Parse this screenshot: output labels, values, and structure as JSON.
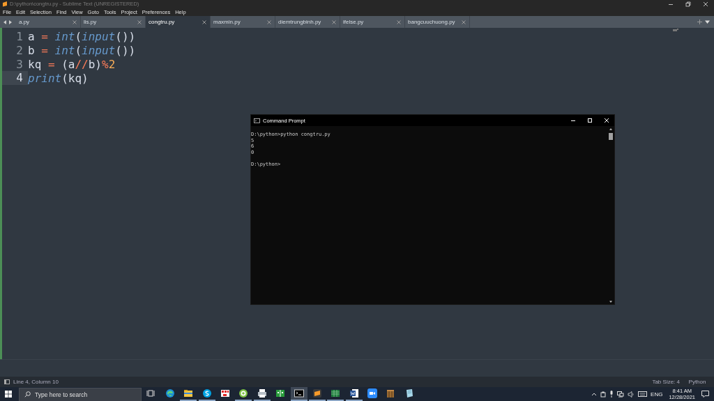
{
  "window": {
    "title": "D:\\python\\congtru.py - Sublime Text (UNREGISTERED)"
  },
  "menu": [
    "File",
    "Edit",
    "Selection",
    "Find",
    "View",
    "Goto",
    "Tools",
    "Project",
    "Preferences",
    "Help"
  ],
  "tabs": [
    {
      "label": "a.py",
      "selected": false
    },
    {
      "label": "lis.py",
      "selected": false
    },
    {
      "label": "congtru.py",
      "selected": true
    },
    {
      "label": "maxmin.py",
      "selected": false
    },
    {
      "label": "diemtrungbinh.py",
      "selected": false
    },
    {
      "label": "ifelse.py",
      "selected": false
    },
    {
      "label": "bangcuuchuong.py",
      "selected": false
    }
  ],
  "editor": {
    "lines": [
      {
        "number": "1",
        "current": false,
        "tokens": [
          {
            "text": "a ",
            "kind": "plain"
          },
          {
            "text": "= ",
            "kind": "op"
          },
          {
            "text": "int",
            "kind": "builtin"
          },
          {
            "text": "(",
            "kind": "plain"
          },
          {
            "text": "input",
            "kind": "builtin"
          },
          {
            "text": "())",
            "kind": "plain"
          }
        ]
      },
      {
        "number": "2",
        "current": false,
        "tokens": [
          {
            "text": "b ",
            "kind": "plain"
          },
          {
            "text": "= ",
            "kind": "op"
          },
          {
            "text": "int",
            "kind": "builtin"
          },
          {
            "text": "(",
            "kind": "plain"
          },
          {
            "text": "input",
            "kind": "builtin"
          },
          {
            "text": "())",
            "kind": "plain"
          }
        ]
      },
      {
        "number": "3",
        "current": false,
        "tokens": [
          {
            "text": "kq ",
            "kind": "plain"
          },
          {
            "text": "=",
            "kind": "op"
          },
          {
            "text": " (a",
            "kind": "plain"
          },
          {
            "text": "//",
            "kind": "op"
          },
          {
            "text": "b)",
            "kind": "plain"
          },
          {
            "text": "%",
            "kind": "op"
          },
          {
            "text": "2",
            "kind": "number"
          }
        ]
      },
      {
        "number": "4",
        "current": true,
        "tokens": [
          {
            "text": "print",
            "kind": "builtin"
          },
          {
            "text": "(kq)",
            "kind": "plain"
          }
        ]
      }
    ]
  },
  "status_bar": {
    "position": "Line 4, Column 10",
    "tab_size": "Tab Size: 4",
    "syntax": "Python"
  },
  "console": {
    "title": "Command Prompt",
    "lines": [
      {
        "text": "D:\\python>python congtru.py",
        "blank_before": false
      },
      {
        "text": "5",
        "blank_before": false
      },
      {
        "text": "6",
        "blank_before": false
      },
      {
        "text": "0",
        "blank_before": false
      },
      {
        "text": "D:\\python>",
        "blank_before": true
      }
    ]
  },
  "taskbar": {
    "search": {
      "placeholder": "Type here to search"
    },
    "apps": [
      {
        "kind": "taskview",
        "running": false,
        "selected": false
      },
      {
        "kind": "edge",
        "running": false,
        "selected": false
      },
      {
        "kind": "folder",
        "running": true,
        "selected": false
      },
      {
        "kind": "skype",
        "running": true,
        "selected": false
      },
      {
        "kind": "grid",
        "running": false,
        "selected": false
      },
      {
        "kind": "target",
        "running": true,
        "selected": false
      },
      {
        "kind": "printer",
        "running": true,
        "selected": false
      },
      {
        "kind": "book",
        "running": false,
        "selected": false
      },
      {
        "kind": "terminal",
        "running": true,
        "selected": true
      },
      {
        "kind": "sublime",
        "running": true,
        "selected": false
      },
      {
        "kind": "sheet",
        "running": true,
        "selected": false
      },
      {
        "kind": "word",
        "running": true,
        "selected": false
      },
      {
        "kind": "zoom",
        "running": false,
        "selected": false
      },
      {
        "kind": "box",
        "running": false,
        "selected": false
      },
      {
        "kind": "paper",
        "running": false,
        "selected": false
      }
    ],
    "language": "ENG",
    "time": "8:41 AM",
    "date": "12/28/2021"
  }
}
